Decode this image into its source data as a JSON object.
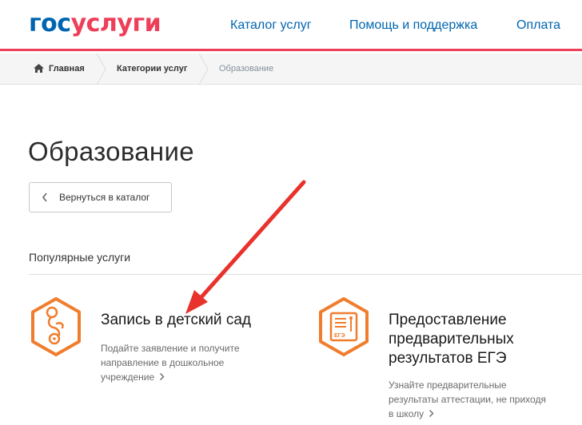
{
  "header": {
    "logo_part1": "гос",
    "logo_part2": "услуги",
    "nav": [
      "Каталог услуг",
      "Помощь и поддержка",
      "Оплата"
    ]
  },
  "breadcrumbs": {
    "home": "Главная",
    "categories": "Категории услуг",
    "current": "Образование"
  },
  "page": {
    "title": "Образование",
    "back_label": "Вернуться в каталог",
    "section_title": "Популярные услуги"
  },
  "services": [
    {
      "icon": "pacifier-icon",
      "title": "Запись в детский сад",
      "desc_lines": [
        "Подайте заявление и получите",
        "направление в дошкольное",
        "учреждение"
      ]
    },
    {
      "icon": "exam-certificate-icon",
      "title_lines": [
        "Предоставление",
        "предварительных",
        "результатов ЕГЭ"
      ],
      "icon_label": "ЕГЭ",
      "desc_lines": [
        "Узнайте предварительные",
        "результаты аттестации, не приходя",
        "в школу"
      ]
    }
  ],
  "colors": {
    "brand_blue": "#0065b1",
    "brand_red": "#ee3f58",
    "icon_orange": "#f07d2d",
    "annotation_arrow": "#e8322b"
  }
}
